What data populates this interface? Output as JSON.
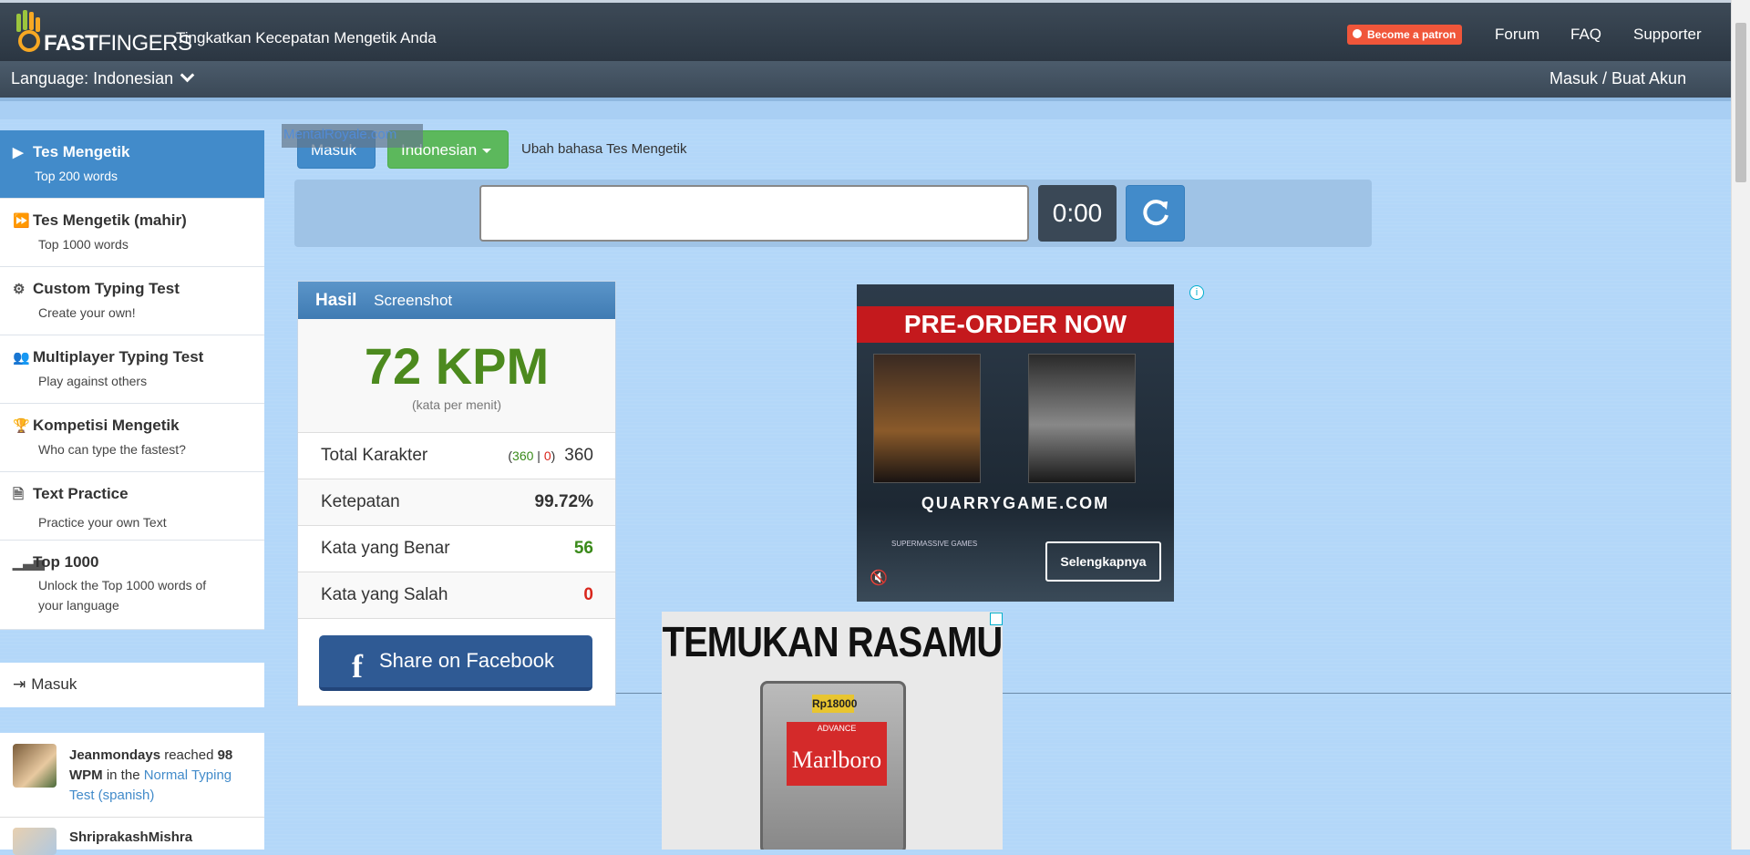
{
  "header": {
    "logo_text_bold": "FAST",
    "logo_text": "FINGERS",
    "tagline": "Tingkatkan Kecepatan Mengetik Anda",
    "patron_label": "Become a patron",
    "nav": [
      "Forum",
      "FAQ",
      "Supporter"
    ],
    "language_label": "Language: Indonesian",
    "login_label": "Masuk / Buat Akun"
  },
  "sidebar": {
    "items": [
      {
        "title": "Tes Mengetik",
        "subtitle": "Top 200 words",
        "icon": "play-icon"
      },
      {
        "title": "Tes Mengetik (mahir)",
        "subtitle": "Top 1000 words",
        "icon": "fast-forward-icon"
      },
      {
        "title": "Custom Typing Test",
        "subtitle": "Create your own!",
        "icon": "gears-icon"
      },
      {
        "title": "Multiplayer Typing Test",
        "subtitle": "Play against others",
        "icon": "users-icon"
      },
      {
        "title": "Kompetisi Mengetik",
        "subtitle": "Who can type the fastest?",
        "icon": "trophy-icon"
      },
      {
        "title": "Text Practice",
        "subtitle": "Practice your own Text",
        "icon": "document-icon"
      },
      {
        "title": "Top 1000",
        "subtitle": "Unlock the Top 1000 words of your language",
        "icon": "signal-icon"
      }
    ],
    "login_label": "Masuk",
    "feed": {
      "name1": "Jeanmondays",
      "text1a": " reached ",
      "wpm1": "98 WPM",
      "text1b": " in the ",
      "link1": "Normal Typing Test (spanish)",
      "name2": "ShriprakashMishra"
    }
  },
  "controls": {
    "login_button": "Masuk",
    "language_button": "Indonesian",
    "change_language": "Ubah bahasa Tes Mengetik",
    "watermark": "MentalRoyale.com",
    "input_value": "",
    "timer": "0:00"
  },
  "results": {
    "tab_active": "Hasil",
    "tab_other": "Screenshot",
    "wpm": "72 KPM",
    "wpm_note": "(kata per menit)",
    "keystrokes_label": "Total Karakter",
    "keystrokes_open": "(",
    "keystrokes_correct": "360",
    "keystrokes_sep": " | ",
    "keystrokes_wrong": "0",
    "keystrokes_close": ")",
    "keystrokes_total": "360",
    "accuracy_label": "Ketepatan",
    "accuracy_value": "99.72%",
    "correct_label": "Kata yang Benar",
    "correct_value": "56",
    "wrong_label": "Kata yang Salah",
    "wrong_value": "0",
    "facebook_label": "Share on Facebook"
  },
  "ads": {
    "ad1_banner": "PRE-ORDER NOW",
    "ad1_site": "QUARRYGAME.COM",
    "ad1_studio": "SUPERMASSIVE GAMES",
    "ad1_button": "Selengkapnya",
    "ad2_title": "TEMUKAN RASAMU",
    "ad2_price": "Rp18000",
    "ad2_adv": "ADVANCE",
    "ad2_brand": "Marlboro"
  },
  "colors": {
    "brand_blue": "#428bca",
    "wpm_green": "#4c8a1e",
    "error_red": "#d9261c",
    "navbar": "#2b3642"
  }
}
